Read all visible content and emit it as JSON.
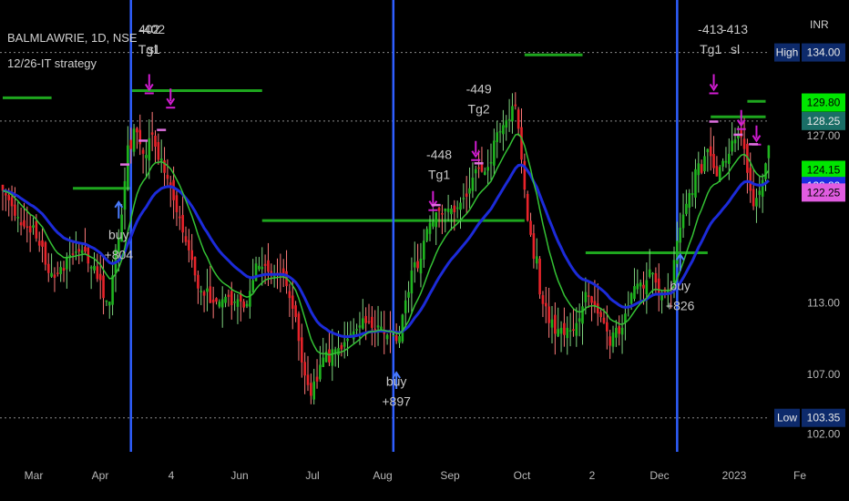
{
  "header": {
    "symbol": "BALMLAWRIE, 1D, NSE",
    "strategy": "12/26-IT strategy",
    "currency": "INR"
  },
  "chart_data": {
    "type": "candlestick",
    "title": "BALMLAWRIE, 1D, NSE",
    "subtitle": "12/26-IT strategy",
    "y_unit": "INR",
    "ylim": [
      100.5,
      138.4
    ],
    "y_ticks": [
      {
        "label": "127.00",
        "value": 127.0
      },
      {
        "label": "113.00",
        "value": 113.0
      },
      {
        "label": "107.00",
        "value": 107.0
      },
      {
        "label": "102.00",
        "value": 102.0
      }
    ],
    "x_ticks": [
      "Mar",
      "Apr",
      "4",
      "Jun",
      "Jul",
      "Aug",
      "Sep",
      "Oct",
      "2",
      "Dec",
      "2023",
      "Fe"
    ],
    "price_tags": [
      {
        "label": "High",
        "value": "134.00",
        "price": 134.0,
        "kind": "high"
      },
      {
        "label": "",
        "value": "129.80",
        "price": 129.8,
        "kind": "green"
      },
      {
        "label": "",
        "value": "128.25",
        "price": 128.25,
        "kind": "teal"
      },
      {
        "label": "",
        "value": "124.15",
        "price": 124.15,
        "kind": "green"
      },
      {
        "label": "",
        "value": "122.80",
        "price": 122.8,
        "kind": "blue"
      },
      {
        "label": "",
        "value": "122.25",
        "price": 122.25,
        "kind": "magenta"
      },
      {
        "label": "Low",
        "value": "103.35",
        "price": 103.35,
        "kind": "low"
      }
    ],
    "dotted_lines": [
      134.0,
      128.25,
      103.35
    ],
    "signals": [
      {
        "type": "buy",
        "text": [
          "buy",
          "+804"
        ],
        "day": 38,
        "price": 120.8
      },
      {
        "type": "exit",
        "text": [
          "402",
          "Tg1"
        ],
        "day": 48,
        "price": 131.0
      },
      {
        "type": "exit",
        "text": [
          "-402",
          "sl"
        ],
        "day": 49,
        "price": 131.0
      },
      {
        "type": "buy",
        "text": [
          "buy",
          "+897"
        ],
        "day": 129,
        "price": 108.5
      },
      {
        "type": "exit",
        "text": [
          "-448",
          "Tg1"
        ],
        "day": 143,
        "price": 120.5
      },
      {
        "type": "exit",
        "text": [
          "-449",
          "Tg2"
        ],
        "day": 156,
        "price": 126.0
      },
      {
        "type": "buy",
        "text": [
          "buy",
          "+826"
        ],
        "day": 222,
        "price": 116.5
      },
      {
        "type": "exit",
        "text": [
          "-413",
          "Tg1"
        ],
        "day": 232,
        "price": 131.0
      },
      {
        "type": "exit",
        "text": [
          "-413",
          "sl"
        ],
        "day": 240,
        "price": 131.0
      }
    ],
    "markers": {
      "magenta_down": [
        [
          48,
          130.8
        ],
        [
          55,
          129.6
        ],
        [
          141,
          121.0
        ],
        [
          155,
          125.2
        ],
        [
          233,
          130.8
        ],
        [
          242,
          127.8
        ],
        [
          247,
          126.5
        ]
      ],
      "blue_up": [
        [
          38,
          121.6
        ],
        [
          129,
          107.3
        ],
        [
          222,
          117.2
        ]
      ],
      "pink_entry": [
        [
          40,
          124.6
        ],
        [
          46,
          126.6
        ],
        [
          52,
          127.5
        ],
        [
          142,
          121.2
        ],
        [
          156,
          124.7
        ],
        [
          233,
          128.2
        ],
        [
          241,
          127.1
        ],
        [
          246,
          126.3
        ]
      ]
    },
    "vertical_lines": [
      42,
      128,
      221
    ],
    "levels": [
      {
        "x0": 0,
        "x1": 16,
        "price": 130.2
      },
      {
        "x0": 23,
        "x1": 42,
        "price": 122.6
      },
      {
        "x0": 42,
        "x1": 85,
        "price": 130.8
      },
      {
        "x0": 85,
        "x1": 171,
        "price": 119.9
      },
      {
        "x0": 171,
        "x1": 190,
        "price": 133.8
      },
      {
        "x0": 191,
        "x1": 231,
        "price": 117.2
      },
      {
        "x0": 232,
        "x1": 250,
        "price": 128.6
      },
      {
        "x0": 244,
        "x1": 250,
        "price": 129.9
      }
    ],
    "series_close": [
      122.4,
      122.0,
      121.6,
      121.1,
      120.3,
      120.2,
      119.5,
      119.4,
      119.3,
      118.9,
      119.5,
      118.4,
      117.8,
      117.7,
      116.2,
      115.5,
      115.5,
      115.1,
      115.5,
      116.0,
      115.7,
      116.8,
      117.0,
      117.1,
      117.3,
      117.3,
      117.4,
      117.3,
      116.3,
      116.0,
      116.1,
      115.0,
      114.9,
      113.4,
      113.2,
      113.1,
      115.3,
      117.5,
      118.5,
      120.4,
      123.2,
      126.2,
      125.9,
      127.6,
      127.3,
      126.3,
      125.5,
      125.4,
      126.8,
      127.1,
      126.1,
      125.0,
      125.1,
      123.9,
      123.4,
      122.8,
      121.6,
      120.6,
      120.1,
      118.9,
      118.1,
      117.4,
      116.6,
      115.3,
      114.2,
      114.0,
      113.6,
      114.2,
      113.0,
      113.0,
      113.1,
      113.1,
      113.3,
      113.5,
      113.5,
      112.8,
      113.1,
      113.3,
      113.1,
      112.6,
      112.9,
      114.0,
      114.9,
      116.3,
      116.1,
      116.0,
      116.1,
      115.6,
      115.3,
      115.3,
      115.3,
      115.4,
      115.2,
      114.4,
      113.4,
      112.5,
      111.8,
      109.8,
      108.0,
      106.9,
      106.1,
      105.2,
      106.4,
      106.4,
      107.8,
      108.4,
      108.9,
      108.0,
      109.1,
      109.1,
      109.2,
      109.1,
      109.7,
      110.0,
      110.4,
      110.6,
      110.8,
      111.1,
      111.7,
      111.3,
      111.4,
      110.9,
      110.7,
      111.1,
      111.0,
      110.4,
      110.3,
      110.5,
      110.3,
      109.8,
      110.2,
      112.0,
      113.2,
      113.9,
      115.7,
      116.4,
      115.9,
      116.7,
      118.2,
      119.2,
      119.7,
      119.8,
      120.6,
      120.7,
      120.4,
      120.9,
      120.9,
      120.9,
      120.6,
      121.0,
      121.4,
      121.8,
      121.9,
      122.6,
      123.5,
      124.2,
      124.3,
      124.0,
      124.0,
      124.4,
      124.8,
      126.6,
      127.3,
      127.4,
      127.9,
      128.3,
      128.4,
      129.5,
      129.5,
      127.6,
      125.0,
      122.5,
      119.9,
      118.7,
      116.7,
      116.9,
      113.7,
      112.9,
      112.7,
      111.3,
      111.6,
      110.4,
      110.8,
      110.9,
      110.3,
      110.9,
      110.7,
      110.7,
      111.3,
      111.7,
      112.7,
      113.9,
      113.6,
      113.0,
      112.7,
      112.1,
      111.8,
      111.3,
      110.6,
      109.4,
      110.5,
      110.9,
      110.4,
      110.9,
      112.1,
      112.8,
      113.8,
      114.4,
      114.6,
      114.7,
      114.2,
      114.9,
      115.8,
      115.5,
      114.7,
      113.7,
      113.9,
      113.9,
      114.1,
      114.2,
      116.6,
      118.2,
      119.3,
      120.4,
      121.3,
      122.2,
      122.2,
      124.2,
      124.7,
      123.9,
      125.3,
      125.9,
      125.3,
      124.3,
      123.6,
      124.4,
      124.9,
      124.9,
      125.5,
      126.6,
      126.7,
      127.1,
      126.9,
      125.9,
      123.9,
      122.4,
      121.1,
      121.8,
      122.4,
      123.3,
      124.7,
      126.2
    ]
  }
}
